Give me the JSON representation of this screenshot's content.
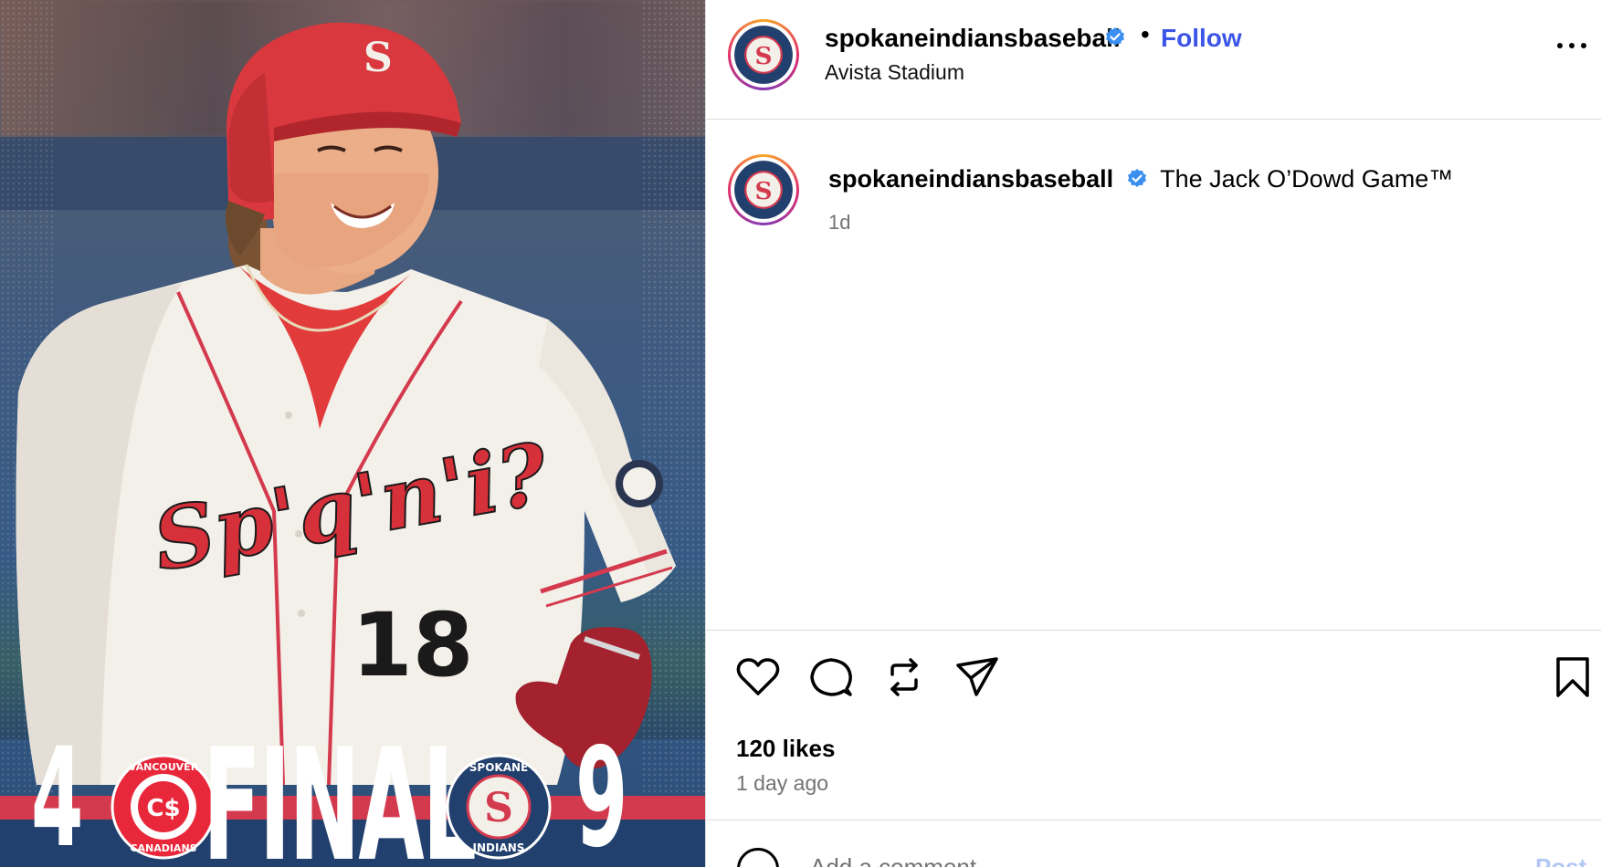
{
  "post": {
    "image": {
      "score_away": "4",
      "score_home": "9",
      "final_label": "FINAL",
      "jersey_script": "Sp'q'n'i?",
      "jersey_number": "18",
      "helmet_letter": "S",
      "away_team_logo_text": [
        "VANCOUVER",
        "CANADIANS"
      ],
      "home_team_logo_text": [
        "SPOKANE",
        "INDIANS"
      ]
    },
    "header": {
      "username": "spokaneindiansbaseball",
      "separator": "•",
      "follow_label": "Follow",
      "location": "Avista Stadium"
    },
    "caption": {
      "username": "spokaneindiansbaseball",
      "text": "The Jack O’Dowd Game™",
      "time": "1d"
    },
    "stats": {
      "likes": "120 likes",
      "age": "1 day ago"
    },
    "comment": {
      "placeholder": "Add a comment…",
      "post_label": "Post"
    }
  },
  "colors": {
    "follow_blue": "#3b55e6",
    "verified_blue": "#3a8ff0",
    "muted_text": "#737373",
    "divider": "#dbdbdb",
    "team_red": "#d43a4e",
    "team_navy": "#22406e"
  },
  "icons": [
    "verified-icon",
    "more-options-icon",
    "heart-icon",
    "comment-icon",
    "repost-icon",
    "share-icon",
    "bookmark-icon",
    "emoji-icon"
  ]
}
